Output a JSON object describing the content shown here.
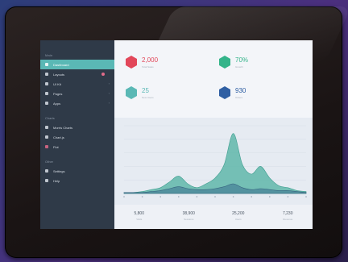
{
  "sidebar": {
    "section1": "Main",
    "items": [
      {
        "label": "Dashboard",
        "active": true
      },
      {
        "label": "Layouts",
        "badge": true
      },
      {
        "label": "UI Kit"
      },
      {
        "label": "Pages"
      },
      {
        "label": "Apps"
      }
    ],
    "section2": "Charts",
    "items2": [
      {
        "label": "Morris Charts"
      },
      {
        "label": "Chart.js"
      },
      {
        "label": "Flot"
      }
    ],
    "section3": "Other",
    "items3": [
      {
        "label": "Settings"
      },
      {
        "label": "Help"
      }
    ]
  },
  "stats": [
    {
      "value": "2,000",
      "sub": "Total Sales",
      "color": "#e2475a"
    },
    {
      "value": "70%",
      "sub": "Growth",
      "color": "#34b48a"
    },
    {
      "value": "25",
      "sub": "New Users",
      "color": "#5ab8b5"
    },
    {
      "value": "930",
      "sub": "Orders",
      "color": "#2f5fa3"
    }
  ],
  "chart_data": {
    "type": "area",
    "x": [
      0,
      1,
      2,
      3,
      4,
      5,
      6,
      7,
      8,
      9,
      10,
      11,
      12,
      13,
      14,
      15,
      16,
      17,
      18,
      19,
      20
    ],
    "series": [
      {
        "values": [
          1,
          1,
          2,
          4,
          6,
          12,
          18,
          10,
          6,
          10,
          16,
          30,
          62,
          30,
          20,
          28,
          16,
          8,
          6,
          3,
          2
        ]
      },
      {
        "values": [
          1,
          1,
          1,
          2,
          3,
          5,
          7,
          5,
          4,
          4,
          5,
          7,
          10,
          6,
          4,
          5,
          4,
          3,
          3,
          2,
          1
        ]
      }
    ],
    "xlabel": "",
    "ylabel": "",
    "ylim": [
      0,
      70
    ],
    "grid": true
  },
  "footer": [
    {
      "value": "5,800",
      "label": "Visits"
    },
    {
      "value": "38,900",
      "label": "Sessions"
    },
    {
      "value": "25,200",
      "label": "Users"
    },
    {
      "value": "7,230",
      "label": "Revenue"
    }
  ]
}
